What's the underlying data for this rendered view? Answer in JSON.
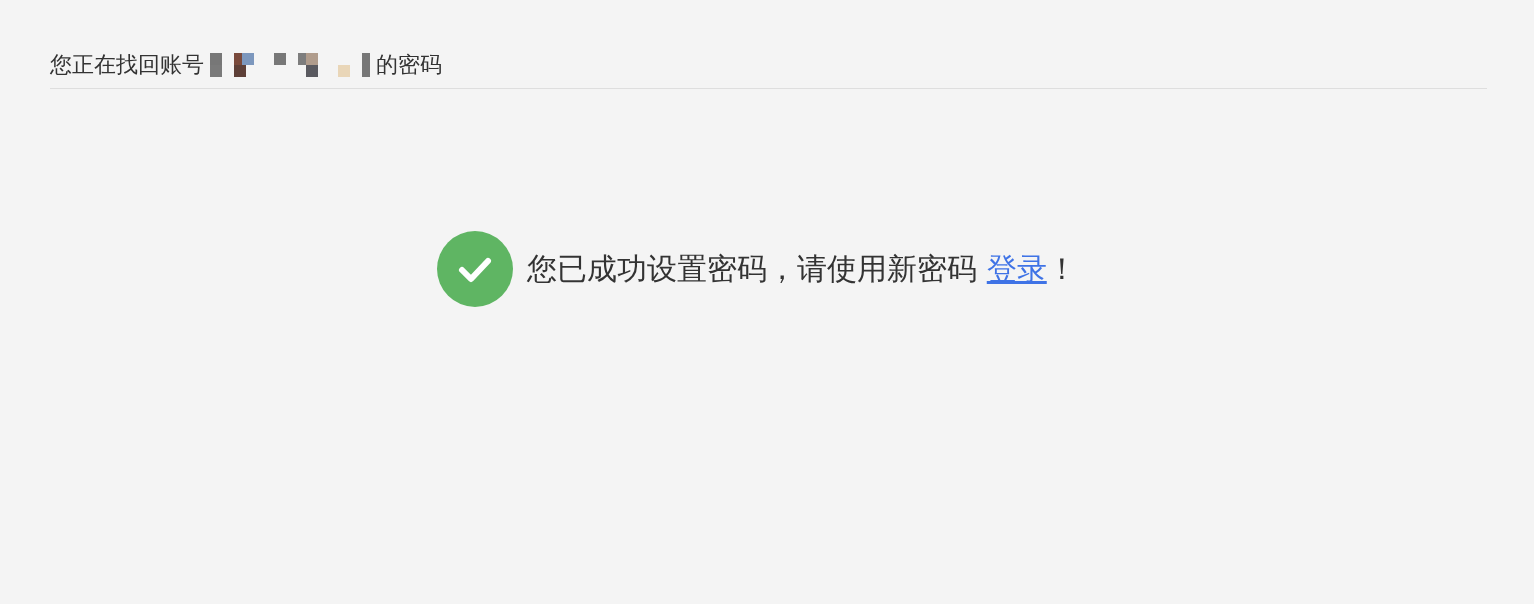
{
  "header": {
    "prefix": "您正在找回账号",
    "suffix": "的密码"
  },
  "message": {
    "kind": "success",
    "text_before": "您已成功设置密码，请使用新密码 ",
    "link": "登录",
    "text_after": "！"
  }
}
